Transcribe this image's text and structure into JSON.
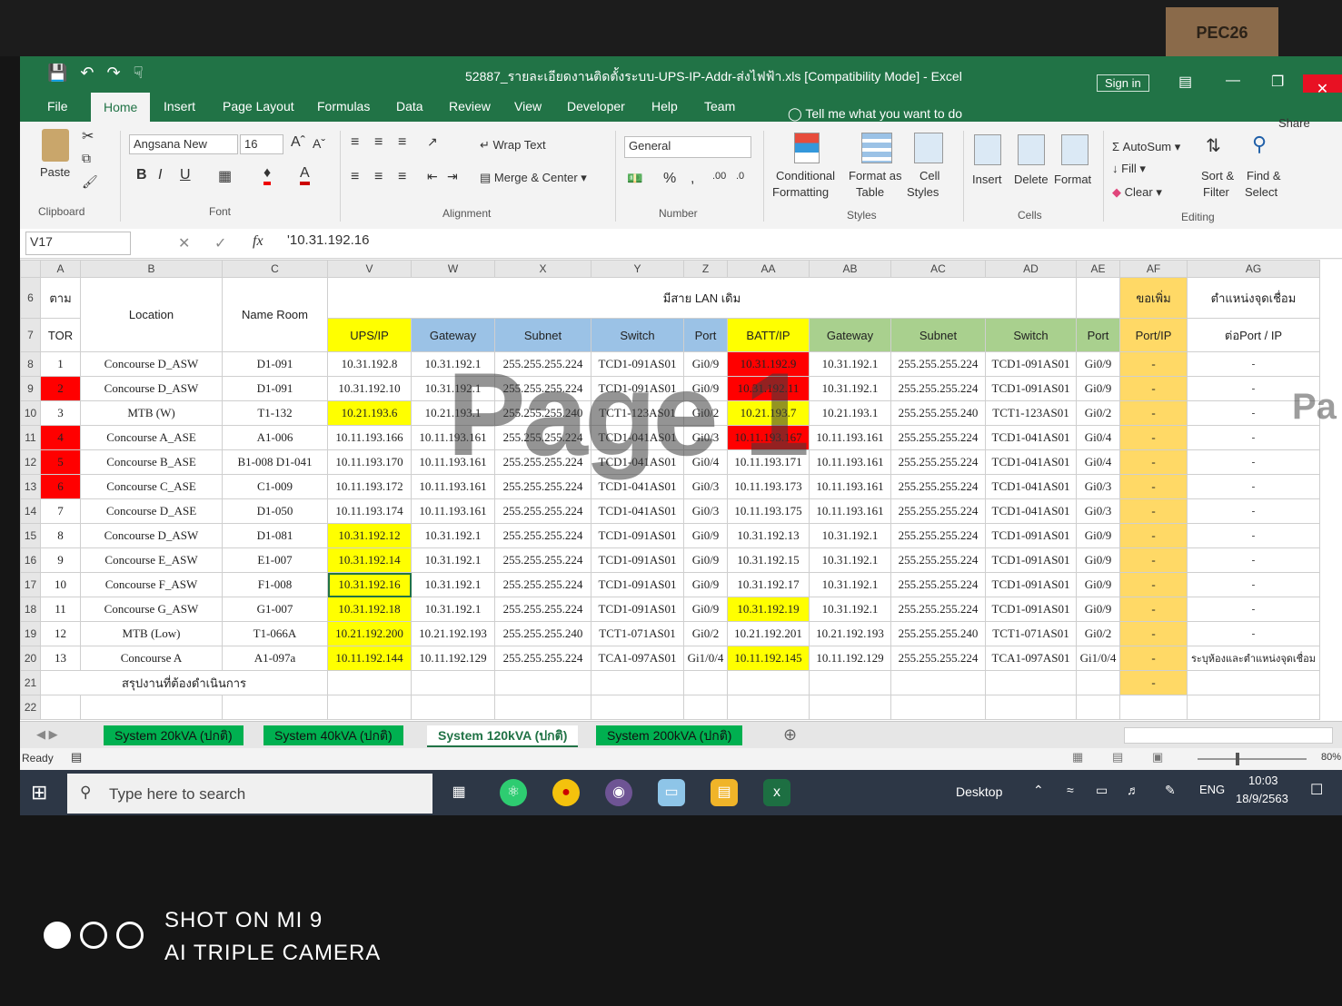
{
  "sticker": "PEC26",
  "titlebar": {
    "title": "52887_รายละเอียดงานติดตั้งระบบ-UPS-IP-Addr-ส่งไฟฟ้า.xls  [Compatibility Mode]  -  Excel",
    "signin": "Sign in"
  },
  "tabs": [
    "File",
    "Home",
    "Insert",
    "Page Layout",
    "Formulas",
    "Data",
    "Review",
    "View",
    "Developer",
    "Help",
    "Team"
  ],
  "tellme": "Tell me what you want to do",
  "share": "Share",
  "ribbon": {
    "paste": "Paste",
    "clipboard": "Clipboard",
    "font_name": "Angsana New",
    "font_size": "16",
    "font": "Font",
    "wrap_text": "Wrap Text",
    "merge_center": "Merge & Center",
    "alignment": "Alignment",
    "number_format": "General",
    "number": "Number",
    "conditional_formatting_1": "Conditional",
    "conditional_formatting_2": "Formatting",
    "format_as_table_1": "Format as",
    "format_as_table_2": "Table",
    "cell_styles_1": "Cell",
    "cell_styles_2": "Styles",
    "styles": "Styles",
    "insert": "Insert",
    "delete": "Delete",
    "format": "Format",
    "cells": "Cells",
    "autosum": "AutoSum",
    "fill": "Fill",
    "clear": "Clear",
    "sort_filter_1": "Sort &",
    "sort_filter_2": "Filter",
    "find_select_1": "Find &",
    "find_select_2": "Select",
    "editing": "Editing"
  },
  "formula_bar": {
    "name_box": "V17",
    "fx": "fx",
    "content": "'10.31.192.16"
  },
  "columns": [
    "A",
    "B",
    "C",
    "V",
    "W",
    "X",
    "Y",
    "Z",
    "AA",
    "AB",
    "AC",
    "AD",
    "AE",
    "AF",
    "AG"
  ],
  "header": {
    "no_top": "ตาม",
    "no_bottom": "TOR",
    "location": "Location",
    "name_room": "Name Room",
    "lan_group": "มีสาย LAN เดิม",
    "ups_ip": "UPS/IP",
    "gateway": "Gateway",
    "subnet": "Subnet",
    "switch": "Switch",
    "port": "Port",
    "batt_ip": "BATT/IP",
    "gateway2": "Gateway",
    "subnet2": "Subnet",
    "switch2": "Switch",
    "port2": "Port",
    "af_top": "ขอเพิ่ม",
    "af_bottom": "Port/IP",
    "ag_top": "ตำแหน่งจุดเชื่อม",
    "ag_bottom": "ต่อPort / IP"
  },
  "rows": [
    {
      "r": "8",
      "no": "1",
      "loc": "Concourse D_ASW",
      "room": "D1-091",
      "ups": "10.31.192.8",
      "gw": "10.31.192.1",
      "sub": "255.255.255.224",
      "sw": "TCD1-091AS01",
      "port": "Gi0/9",
      "batt": "10.31.192.9",
      "gw2": "10.31.192.1",
      "sub2": "255.255.255.224",
      "sw2": "TCD1-091AS01",
      "port2": "Gi0/9",
      "af": "-",
      "ag": "-"
    },
    {
      "r": "9",
      "no": "2",
      "loc": "Concourse D_ASW",
      "room": "D1-091",
      "ups": "10.31.192.10",
      "gw": "10.31.192.1",
      "sub": "255.255.255.224",
      "sw": "TCD1-091AS01",
      "port": "Gi0/9",
      "batt": "10.31.192.11",
      "gw2": "10.31.192.1",
      "sub2": "255.255.255.224",
      "sw2": "TCD1-091AS01",
      "port2": "Gi0/9",
      "af": "-",
      "ag": "-"
    },
    {
      "r": "10",
      "no": "3",
      "loc": "MTB (W)",
      "room": "T1-132",
      "ups": "10.21.193.6",
      "gw": "10.21.193.1",
      "sub": "255.255.255.240",
      "sw": "TCT1-123AS01",
      "port": "Gi0/2",
      "batt": "10.21.193.7",
      "gw2": "10.21.193.1",
      "sub2": "255.255.255.240",
      "sw2": "TCT1-123AS01",
      "port2": "Gi0/2",
      "af": "-",
      "ag": "-"
    },
    {
      "r": "11",
      "no": "4",
      "loc": "Concourse A_ASE",
      "room": "A1-006",
      "ups": "10.11.193.166",
      "gw": "10.11.193.161",
      "sub": "255.255.255.224",
      "sw": "TCD1-041AS01",
      "port": "Gi0/3",
      "batt": "10.11.193.167",
      "gw2": "10.11.193.161",
      "sub2": "255.255.255.224",
      "sw2": "TCD1-041AS01",
      "port2": "Gi0/4",
      "af": "-",
      "ag": "-"
    },
    {
      "r": "12",
      "no": "5",
      "loc": "Concourse B_ASE",
      "room": "B1-008 D1-041",
      "ups": "10.11.193.170",
      "gw": "10.11.193.161",
      "sub": "255.255.255.224",
      "sw": "TCD1-041AS01",
      "port": "Gi0/4",
      "batt": "10.11.193.171",
      "gw2": "10.11.193.161",
      "sub2": "255.255.255.224",
      "sw2": "TCD1-041AS01",
      "port2": "Gi0/4",
      "af": "-",
      "ag": "-"
    },
    {
      "r": "13",
      "no": "6",
      "loc": "Concourse C_ASE",
      "room": "C1-009",
      "ups": "10.11.193.172",
      "gw": "10.11.193.161",
      "sub": "255.255.255.224",
      "sw": "TCD1-041AS01",
      "port": "Gi0/3",
      "batt": "10.11.193.173",
      "gw2": "10.11.193.161",
      "sub2": "255.255.255.224",
      "sw2": "TCD1-041AS01",
      "port2": "Gi0/3",
      "af": "-",
      "ag": "-"
    },
    {
      "r": "14",
      "no": "7",
      "loc": "Concourse D_ASE",
      "room": "D1-050",
      "ups": "10.11.193.174",
      "gw": "10.11.193.161",
      "sub": "255.255.255.224",
      "sw": "TCD1-041AS01",
      "port": "Gi0/3",
      "batt": "10.11.193.175",
      "gw2": "10.11.193.161",
      "sub2": "255.255.255.224",
      "sw2": "TCD1-041AS01",
      "port2": "Gi0/3",
      "af": "-",
      "ag": "-"
    },
    {
      "r": "15",
      "no": "8",
      "loc": "Concourse D_ASW",
      "room": "D1-081",
      "ups": "10.31.192.12",
      "gw": "10.31.192.1",
      "sub": "255.255.255.224",
      "sw": "TCD1-091AS01",
      "port": "Gi0/9",
      "batt": "10.31.192.13",
      "gw2": "10.31.192.1",
      "sub2": "255.255.255.224",
      "sw2": "TCD1-091AS01",
      "port2": "Gi0/9",
      "af": "-",
      "ag": "-"
    },
    {
      "r": "16",
      "no": "9",
      "loc": "Concourse E_ASW",
      "room": "E1-007",
      "ups": "10.31.192.14",
      "gw": "10.31.192.1",
      "sub": "255.255.255.224",
      "sw": "TCD1-091AS01",
      "port": "Gi0/9",
      "batt": "10.31.192.15",
      "gw2": "10.31.192.1",
      "sub2": "255.255.255.224",
      "sw2": "TCD1-091AS01",
      "port2": "Gi0/9",
      "af": "-",
      "ag": "-"
    },
    {
      "r": "17",
      "no": "10",
      "loc": "Concourse F_ASW",
      "room": "F1-008",
      "ups": "10.31.192.16",
      "gw": "10.31.192.1",
      "sub": "255.255.255.224",
      "sw": "TCD1-091AS01",
      "port": "Gi0/9",
      "batt": "10.31.192.17",
      "gw2": "10.31.192.1",
      "sub2": "255.255.255.224",
      "sw2": "TCD1-091AS01",
      "port2": "Gi0/9",
      "af": "-",
      "ag": "-"
    },
    {
      "r": "18",
      "no": "11",
      "loc": "Concourse G_ASW",
      "room": "G1-007",
      "ups": "10.31.192.18",
      "gw": "10.31.192.1",
      "sub": "255.255.255.224",
      "sw": "TCD1-091AS01",
      "port": "Gi0/9",
      "batt": "10.31.192.19",
      "gw2": "10.31.192.1",
      "sub2": "255.255.255.224",
      "sw2": "TCD1-091AS01",
      "port2": "Gi0/9",
      "af": "-",
      "ag": "-"
    },
    {
      "r": "19",
      "no": "12",
      "loc": "MTB (Low)",
      "room": "T1-066A",
      "ups": "10.21.192.200",
      "gw": "10.21.192.193",
      "sub": "255.255.255.240",
      "sw": "TCT1-071AS01",
      "port": "Gi0/2",
      "batt": "10.21.192.201",
      "gw2": "10.21.192.193",
      "sub2": "255.255.255.240",
      "sw2": "TCT1-071AS01",
      "port2": "Gi0/2",
      "af": "-",
      "ag": "-"
    },
    {
      "r": "20",
      "no": "13",
      "loc": "Concourse A",
      "room": "A1-097a",
      "ups": "10.11.192.144",
      "gw": "10.11.192.129",
      "sub": "255.255.255.224",
      "sw": "TCA1-097AS01",
      "port": "Gi1/0/4",
      "batt": "10.11.192.145",
      "gw2": "10.11.192.129",
      "sub2": "255.255.255.224",
      "sw2": "TCA1-097AS01",
      "port2": "Gi1/0/4",
      "af": "-",
      "ag": "ระบุห้องและตำแหน่งจุดเชื่อม"
    }
  ],
  "summary_row": {
    "r": "21",
    "label": "สรุปงานที่ต้องดำเนินการ",
    "af": "-"
  },
  "row22": "22",
  "row_nums_hdr": [
    "6",
    "7"
  ],
  "watermark": "Page 1",
  "watermark_edge": "Pa",
  "sheet_tabs": [
    "System 20kVA  (ปกติ)",
    "System 40kVA  (ปกติ)",
    "System 120kVA (ปกติ)",
    "System 200kVA (ปกติ)"
  ],
  "status": "Ready",
  "zoom": "80%",
  "taskbar": {
    "search": "Type here to search",
    "desktop": "Desktop",
    "lang": "ENG",
    "time": "10:03",
    "date": "18/9/2563"
  },
  "camera": {
    "line1": "SHOT ON MI 9",
    "line2": "AI TRIPLE CAMERA"
  }
}
